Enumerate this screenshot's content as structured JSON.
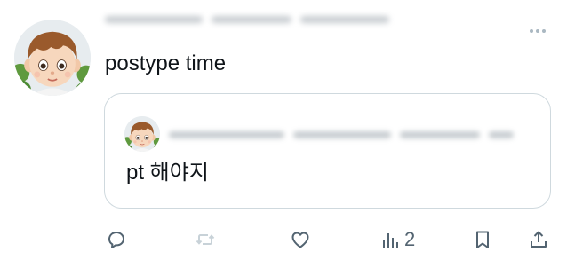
{
  "tweet": {
    "text": "postype time"
  },
  "quote": {
    "text": "pt 해야지"
  },
  "actions": {
    "reply_icon": "reply-icon",
    "retweet_icon": "retweet-icon",
    "like_icon": "heart-icon",
    "views_icon": "views-chart-icon",
    "views_count": "2",
    "bookmark_icon": "bookmark-icon",
    "share_icon": "share-icon"
  },
  "colors": {
    "text": "#0f1419",
    "muted": "#536471",
    "border": "#cfd9de",
    "retweet_disabled": "#c8d2d8"
  }
}
